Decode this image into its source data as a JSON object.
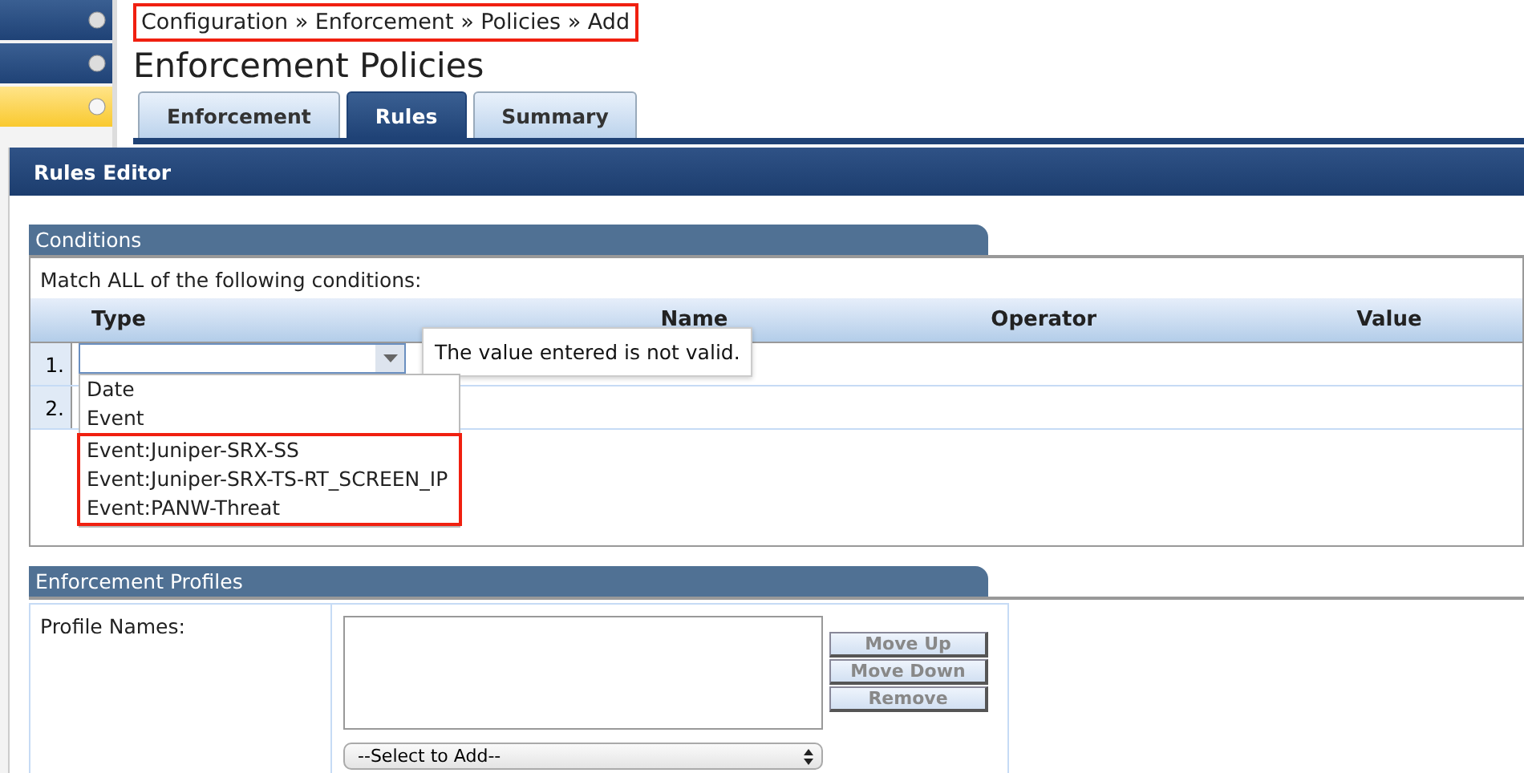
{
  "sidebar": {
    "items": [
      {
        "selected": false
      },
      {
        "selected": false
      },
      {
        "selected": true
      }
    ]
  },
  "breadcrumb": {
    "text": "Configuration » Enforcement » Policies » Add",
    "highlighted": true
  },
  "page_title": "Enforcement Policies",
  "tabs": [
    {
      "label": "Enforcement",
      "selected": false
    },
    {
      "label": "Rules",
      "selected": true
    },
    {
      "label": "Summary",
      "selected": false
    }
  ],
  "dialog": {
    "title": "Rules Editor",
    "conditions": {
      "title": "Conditions",
      "match_text": "Match ALL of the following conditions:",
      "columns": [
        "Type",
        "Name",
        "Operator",
        "Value"
      ],
      "rows": [
        {
          "number": "1."
        },
        {
          "number": "2."
        }
      ],
      "error_tooltip": "The value entered is not valid.",
      "dropdown_options": [
        {
          "label": "Date",
          "highlighted": false
        },
        {
          "label": "Event",
          "highlighted": false
        },
        {
          "label": "Event:Juniper-SRX-SS",
          "highlighted": true
        },
        {
          "label": "Event:Juniper-SRX-TS-RT_SCREEN_IP",
          "highlighted": true
        },
        {
          "label": "Event:PANW-Threat",
          "highlighted": true
        }
      ]
    },
    "profiles": {
      "title": "Enforcement Profiles",
      "label": "Profile Names:",
      "select_placeholder": "--Select to Add--",
      "buttons": [
        {
          "label": "Move Up",
          "disabled": true
        },
        {
          "label": "Move Down",
          "disabled": true
        },
        {
          "label": "Remove",
          "disabled": true
        }
      ]
    }
  }
}
